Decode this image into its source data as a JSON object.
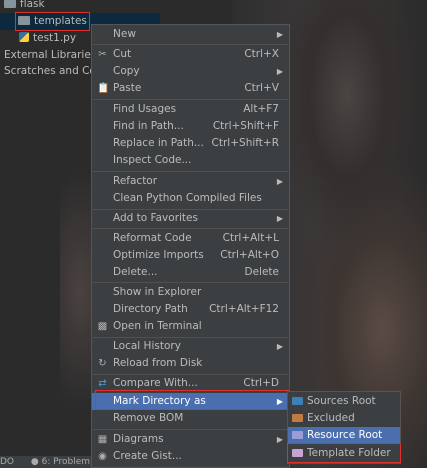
{
  "tree": {
    "flask": "flask",
    "templates": "templates",
    "test1": "test1.py",
    "external": "External Libraries",
    "scratches": "Scratches and Con"
  },
  "status": {
    "left": "DO",
    "problems": "6: Problem"
  },
  "menu": {
    "new": "New",
    "cut": "Cut",
    "cut_sc": "Ctrl+X",
    "copy": "Copy",
    "paste": "Paste",
    "paste_sc": "Ctrl+V",
    "find_usages": "Find Usages",
    "find_usages_sc": "Alt+F7",
    "find_in_path": "Find in Path...",
    "find_in_path_sc": "Ctrl+Shift+F",
    "replace_in_path": "Replace in Path...",
    "replace_in_path_sc": "Ctrl+Shift+R",
    "inspect_code": "Inspect Code...",
    "refactor": "Refactor",
    "clean_python": "Clean Python Compiled Files",
    "add_favorites": "Add to Favorites",
    "reformat": "Reformat Code",
    "reformat_sc": "Ctrl+Alt+L",
    "optimize": "Optimize Imports",
    "optimize_sc": "Ctrl+Alt+O",
    "delete": "Delete...",
    "delete_sc": "Delete",
    "show_explorer": "Show in Explorer",
    "directory_path": "Directory Path",
    "directory_path_sc": "Ctrl+Alt+F12",
    "open_terminal": "Open in Terminal",
    "local_history": "Local History",
    "reload": "Reload from Disk",
    "compare": "Compare With...",
    "compare_sc": "Ctrl+D",
    "mark_dir": "Mark Directory as",
    "remove_bom": "Remove BOM",
    "diagrams": "Diagrams",
    "create_gist": "Create Gist..."
  },
  "submenu": {
    "sources_root": "Sources Root",
    "excluded": "Excluded",
    "resource_root": "Resource Root",
    "template_folder": "Template Folder"
  },
  "colors": {
    "highlight": "#4b6eaf",
    "menu_bg": "#3c3f41",
    "annotation_red": "#e0302b",
    "sources_folder": "#3d7fb6",
    "excluded_folder": "#c07b3f",
    "resource_folder": "#9b9bd8",
    "template_folder": "#c6a3d4"
  }
}
